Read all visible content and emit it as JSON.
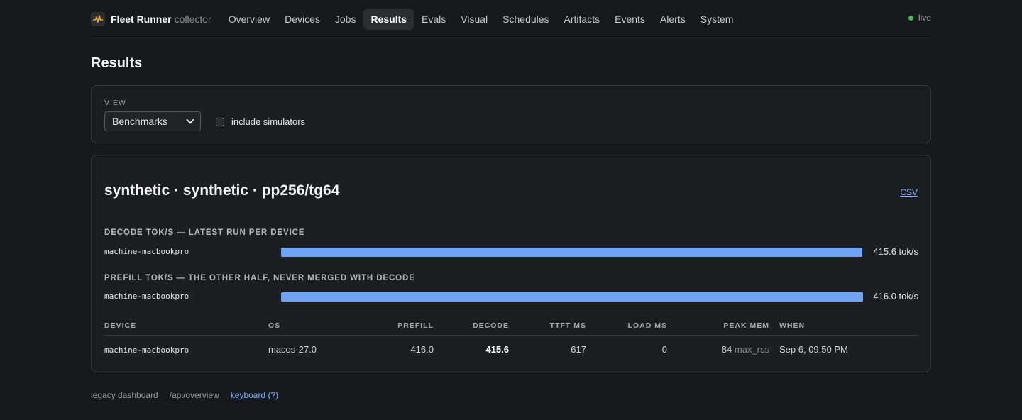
{
  "brand": {
    "name": "Fleet Runner",
    "sub": "collector"
  },
  "nav": [
    {
      "label": "Overview"
    },
    {
      "label": "Devices"
    },
    {
      "label": "Jobs"
    },
    {
      "label": "Results",
      "active": true
    },
    {
      "label": "Evals"
    },
    {
      "label": "Visual"
    },
    {
      "label": "Schedules"
    },
    {
      "label": "Artifacts"
    },
    {
      "label": "Events"
    },
    {
      "label": "Alerts"
    },
    {
      "label": "System"
    }
  ],
  "status": {
    "label": "live",
    "color": "#3fb950"
  },
  "page": {
    "title": "Results"
  },
  "view": {
    "label": "VIEW",
    "selected": "Benchmarks",
    "simulators_label": "include simulators",
    "simulators_checked": false
  },
  "results": {
    "title": "synthetic · synthetic · pp256/tg64",
    "csv_label": "CSV",
    "decode": {
      "label": "DECODE TOK/S — LATEST RUN PER DEVICE",
      "device": "machine-macbookpro",
      "value_text": "415.6 tok/s",
      "value": 415.6,
      "max": 416.0
    },
    "prefill": {
      "label": "PREFILL TOK/S — THE OTHER HALF, NEVER MERGED WITH DECODE",
      "device": "machine-macbookpro",
      "value_text": "416.0 tok/s",
      "value": 416.0,
      "max": 416.0
    },
    "table": {
      "headers": [
        "DEVICE",
        "OS",
        "PREFILL",
        "DECODE",
        "TTFT MS",
        "LOAD MS",
        "PEAK MEM",
        "WHEN"
      ],
      "rows": [
        {
          "device": "machine-macbookpro",
          "os": "macos-27.0",
          "prefill": "416.0",
          "decode": "415.6",
          "ttft": "617",
          "load": "0",
          "mem": "84",
          "mem_unit": "max_rss",
          "when": "Sep 6, 09:50 PM"
        }
      ]
    }
  },
  "footer": {
    "legacy": "legacy dashboard",
    "api": "/api/overview",
    "keyboard": "keyboard (?)"
  },
  "colors": {
    "accent": "#6ea3f5",
    "link": "#8ab4f8",
    "bg": "#17181b"
  }
}
